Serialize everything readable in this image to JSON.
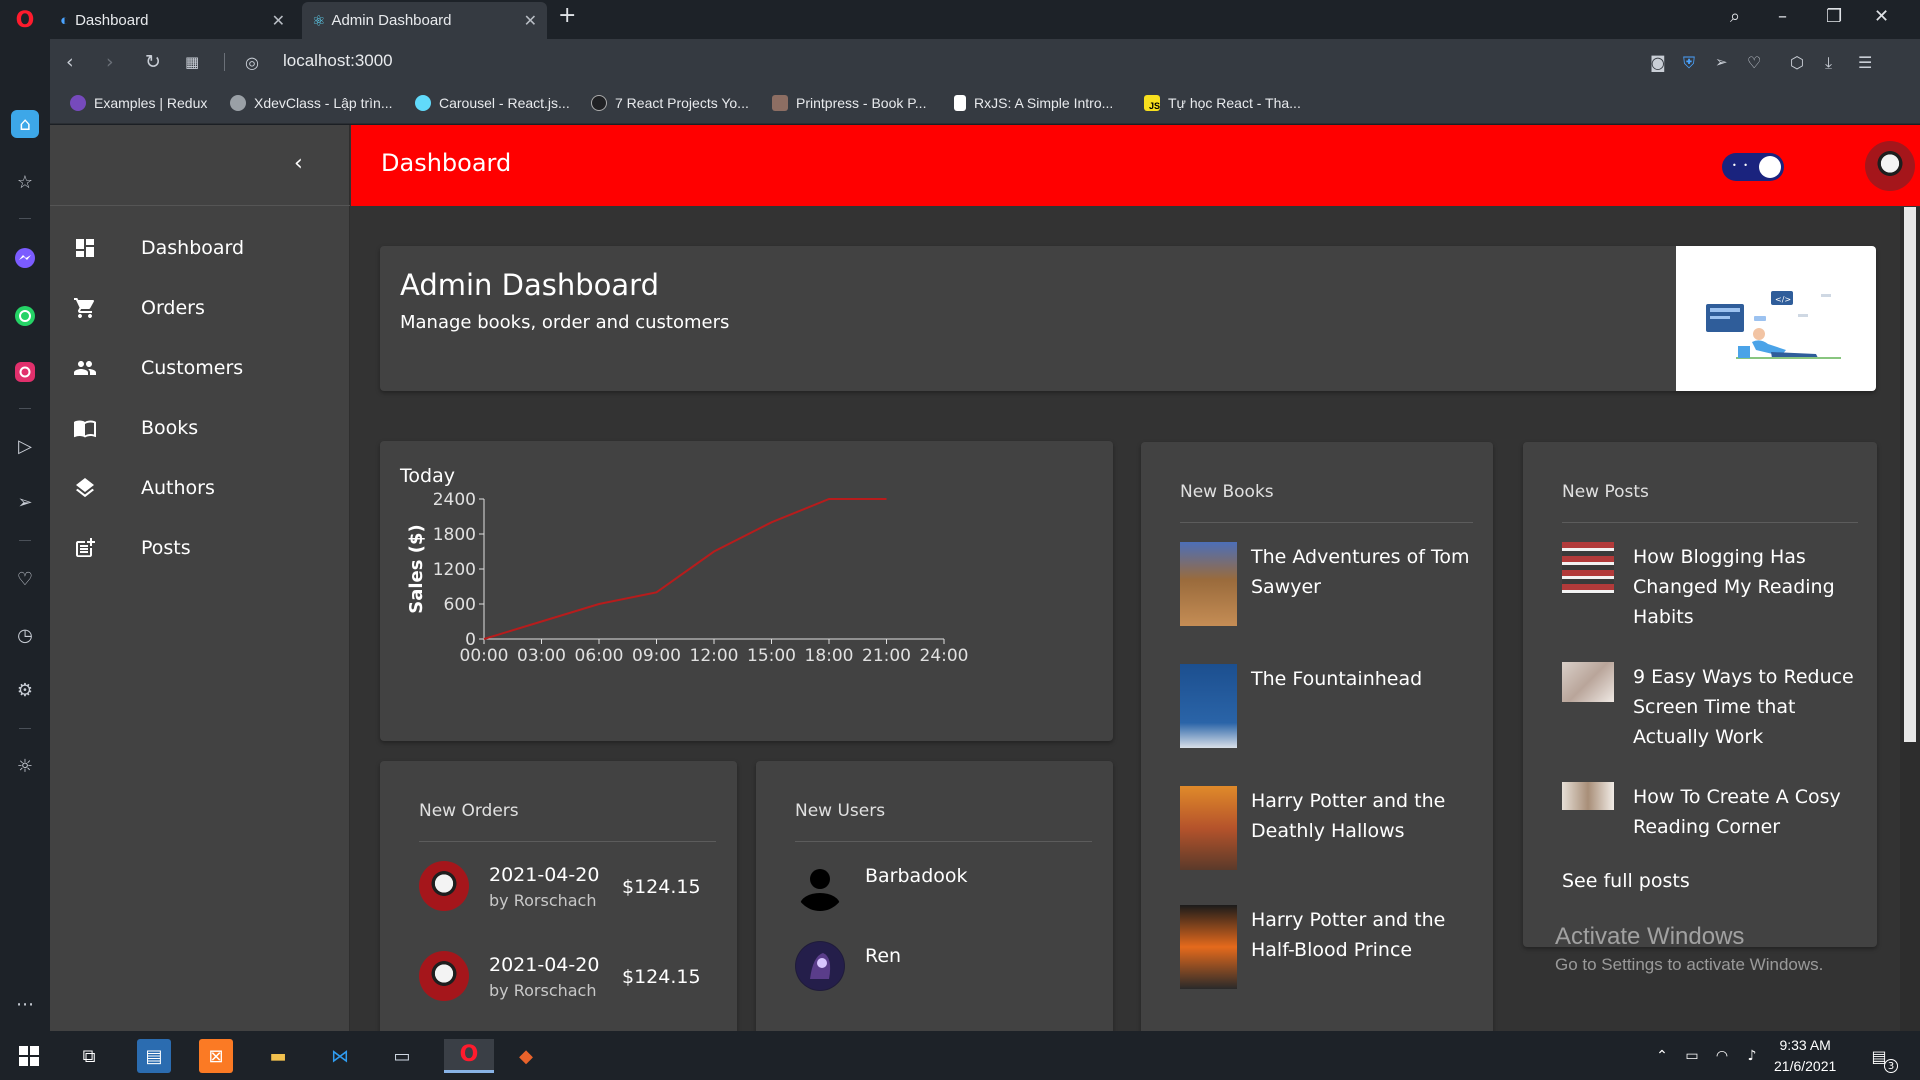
{
  "browser": {
    "tabs": [
      {
        "label": "Dashboard"
      },
      {
        "label": "Admin Dashboard"
      }
    ],
    "url": "localhost:3000",
    "bookmarks": [
      {
        "label": "Examples | Redux",
        "color": "#764abc"
      },
      {
        "label": "XdevClass - Lập trìn...",
        "color": "#9aa0a6"
      },
      {
        "label": "Carousel - React.js...",
        "color": "#61dafb"
      },
      {
        "label": "7 React Projects Yo...",
        "color": "#202124"
      },
      {
        "label": "Printpress - Book P...",
        "color": "#8d6e63"
      },
      {
        "label": "RxJS: A Simple Intro...",
        "color": "#ffffff"
      },
      {
        "label": "Tự học React - Tha...",
        "color": "#f7df1e"
      }
    ]
  },
  "sidebar": {
    "items": [
      {
        "label": "Dashboard",
        "icon": "dashboard-icon"
      },
      {
        "label": "Orders",
        "icon": "cart-icon"
      },
      {
        "label": "Customers",
        "icon": "people-icon"
      },
      {
        "label": "Books",
        "icon": "book-icon"
      },
      {
        "label": "Authors",
        "icon": "layers-icon"
      },
      {
        "label": "Posts",
        "icon": "post-add-icon"
      }
    ]
  },
  "header": {
    "title": "Dashboard",
    "accent": "#ff0000"
  },
  "hero": {
    "title": "Admin Dashboard",
    "subtitle": "Manage books, order and customers"
  },
  "chart_card": {
    "title": "Today"
  },
  "chart_data": {
    "type": "line",
    "title": "Today",
    "xlabel": "",
    "ylabel": "Sales ($)",
    "x": [
      "00:00",
      "03:00",
      "06:00",
      "09:00",
      "12:00",
      "15:00",
      "18:00",
      "21:00"
    ],
    "x_ticks": [
      "00:00",
      "03:00",
      "06:00",
      "09:00",
      "12:00",
      "15:00",
      "18:00",
      "21:00",
      "24:00"
    ],
    "y_ticks": [
      0,
      600,
      1200,
      1800,
      2400
    ],
    "ylim": [
      0,
      2400
    ],
    "series": [
      {
        "values": [
          0,
          300,
          600,
          800,
          1500,
          2000,
          2400,
          2400
        ],
        "color": "#b71c1c"
      }
    ],
    "grid": false
  },
  "orders": {
    "title": "New Orders",
    "items": [
      {
        "date": "2021-04-20",
        "by": "by Rorschach",
        "amount": "$124.15"
      },
      {
        "date": "2021-04-20",
        "by": "by Rorschach",
        "amount": "$124.15"
      }
    ]
  },
  "users": {
    "title": "New Users",
    "items": [
      {
        "name": "Barbadook"
      },
      {
        "name": "Ren"
      }
    ]
  },
  "books": {
    "title": "New Books",
    "items": [
      {
        "title": "The Adventures of Tom Sawyer"
      },
      {
        "title": "The Fountainhead"
      },
      {
        "title": "Harry Potter and the Deathly Hallows"
      },
      {
        "title": "Harry Potter and the Half-Blood Prince"
      }
    ]
  },
  "posts": {
    "title": "New Posts",
    "items": [
      {
        "title": "How Blogging Has Changed My Reading Habits"
      },
      {
        "title": "9 Easy Ways to Reduce Screen Time that Actually Work"
      },
      {
        "title": "How To Create A Cosy Reading Corner"
      }
    ],
    "see_all": "See full posts"
  },
  "watermark": {
    "line1": "Activate Windows",
    "line2": "Go to Settings to activate Windows."
  },
  "taskbar": {
    "time": "9:33 AM",
    "date": "21/6/2021",
    "notifications": "3"
  }
}
